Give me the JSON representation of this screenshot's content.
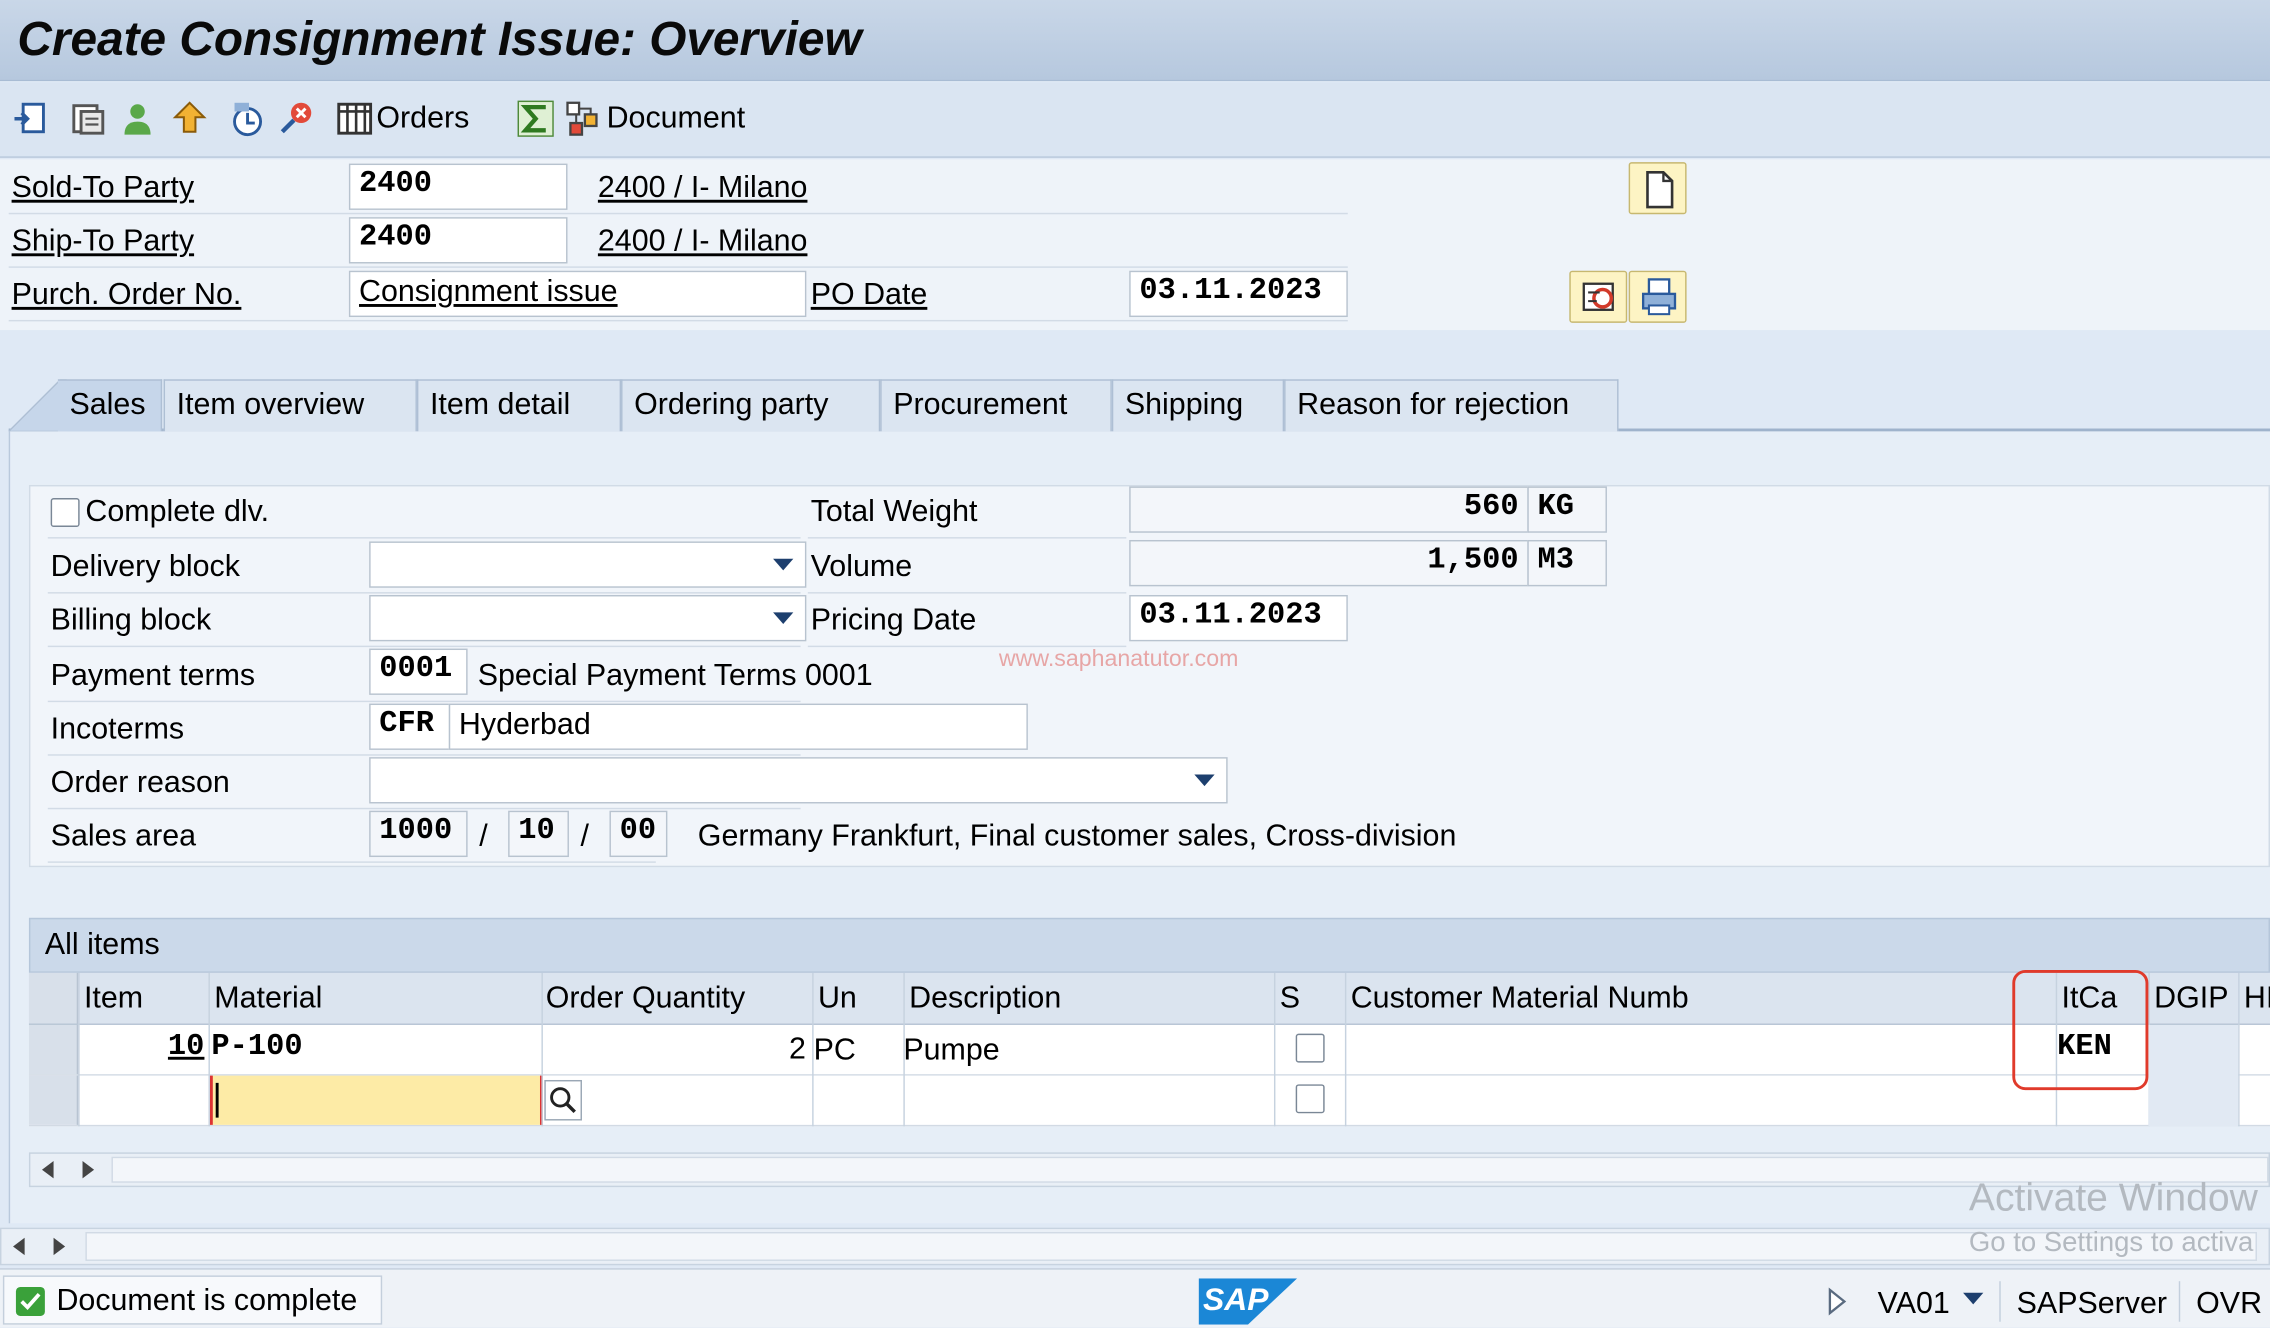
{
  "window": {
    "title": "Create Consignment Issue: Overview"
  },
  "toolbar": {
    "icons": [
      "doc-header-icon",
      "doc-item-icon",
      "partner-icon",
      "upload-icon",
      "display-icon",
      "cancel-icon",
      "orders-grid-icon",
      "sum-icon",
      "document-flow-icon"
    ],
    "orders_label": "Orders",
    "document_label": "Document"
  },
  "header": {
    "sold_to_label": "Sold-To Party",
    "sold_to_value": "2400",
    "sold_to_desc": "2400 / I- Milano",
    "ship_to_label": "Ship-To Party",
    "ship_to_value": "2400",
    "ship_to_desc": "2400 / I- Milano",
    "po_no_label": "Purch. Order No.",
    "po_no_value": "Consignment issue",
    "po_date_label": "PO Date",
    "po_date_value": "03.11.2023"
  },
  "tabs": [
    {
      "label": "Sales",
      "active": true
    },
    {
      "label": "Item overview"
    },
    {
      "label": "Item detail"
    },
    {
      "label": "Ordering party"
    },
    {
      "label": "Procurement"
    },
    {
      "label": "Shipping"
    },
    {
      "label": "Reason for rejection"
    }
  ],
  "sales": {
    "complete_dlv_label": "Complete dlv.",
    "complete_dlv_checked": false,
    "delivery_block_label": "Delivery block",
    "delivery_block_value": "",
    "billing_block_label": "Billing block",
    "billing_block_value": "",
    "payment_terms_label": "Payment terms",
    "payment_terms_value": "0001",
    "payment_terms_desc": "Special Payment Terms 0001",
    "incoterms_label": "Incoterms",
    "incoterms_value": "CFR",
    "incoterms_location": "Hyderbad",
    "order_reason_label": "Order reason",
    "order_reason_value": "",
    "sales_area_label": "Sales area",
    "sales_org": "1000",
    "dist_channel": "10",
    "division": "00",
    "sep": "/",
    "sales_area_desc": "Germany Frankfurt, Final customer sales, Cross-division",
    "total_weight_label": "Total Weight",
    "total_weight_value": "560",
    "total_weight_unit": "KG",
    "volume_label": "Volume",
    "volume_value": "1,500",
    "volume_unit": "M3",
    "pricing_date_label": "Pricing Date",
    "pricing_date_value": "03.11.2023"
  },
  "watermark": "www.saphanatutor.com",
  "items": {
    "title": "All items",
    "columns": [
      "Item",
      "Material",
      "Order Quantity",
      "Un",
      "Description",
      "S",
      "Customer Material Numb",
      "ItCa",
      "DGIP",
      "HI"
    ],
    "rows": [
      {
        "item": "10",
        "material": "P-100",
        "qty": "2",
        "un": "PC",
        "description": "Pumpe",
        "cust_mat": "",
        "itca": "KEN"
      },
      {
        "item": "",
        "material": "",
        "qty": "",
        "un": "",
        "description": "",
        "cust_mat": "",
        "itca": ""
      }
    ]
  },
  "status": {
    "message": "Document is complete",
    "transaction": "VA01",
    "server": "SAPServer",
    "mode": "OVR",
    "logo": "SAP"
  },
  "overlay": {
    "activate_title": "Activate Window",
    "activate_sub": "Go to Settings to activa"
  },
  "colors": {
    "highlight": "#e03a2b",
    "input_focus": "#fdeba6",
    "status_ok": "#3aa13a"
  }
}
